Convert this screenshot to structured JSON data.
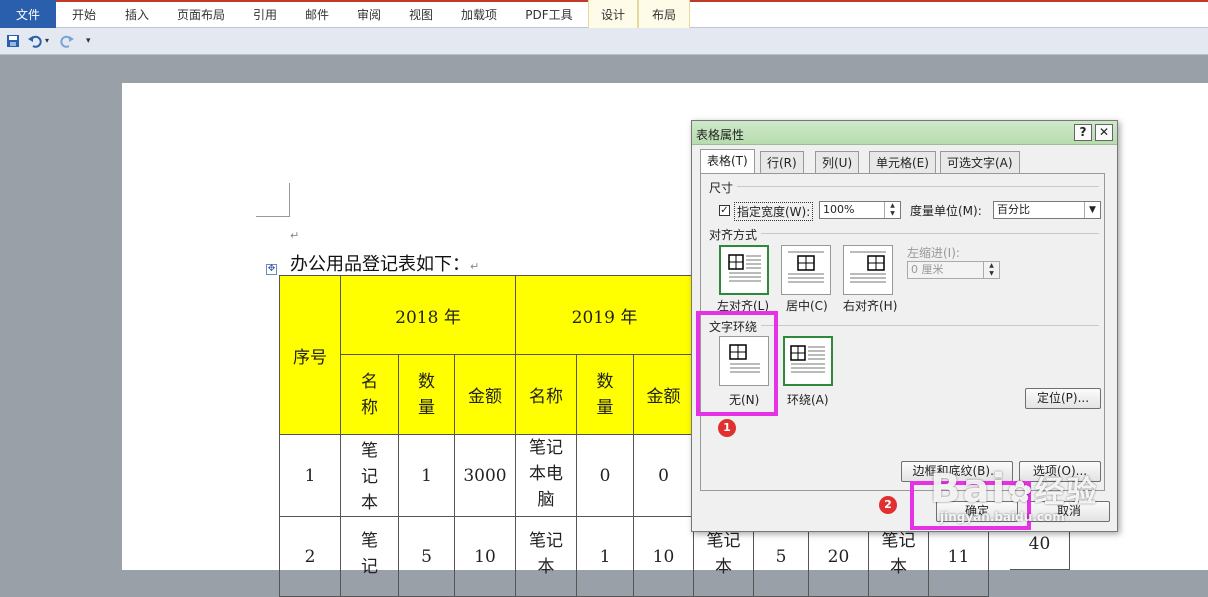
{
  "ribbon": {
    "tabs": [
      "文件",
      "开始",
      "插入",
      "页面布局",
      "引用",
      "邮件",
      "审阅",
      "视图",
      "加载项",
      "PDF工具",
      "设计",
      "布局"
    ]
  },
  "qat": {
    "save_icon": "save-icon",
    "undo_icon": "undo-icon",
    "redo_icon": "redo-icon",
    "more": "▾"
  },
  "document": {
    "intro": "办公用品登记表如下：",
    "para_mark": "↵",
    "table": {
      "header_seq": "序号",
      "year1": "2018 年",
      "year2": "2019 年",
      "sub": [
        "名称",
        "数量",
        "金额",
        "名称",
        "数量",
        "金额"
      ],
      "rows": [
        {
          "seq": "1",
          "name1": "笔记本",
          "qty1": "1",
          "amt1": "3000",
          "name2": "笔记本电脑",
          "qty2": "0",
          "amt2": "0"
        },
        {
          "seq": "2",
          "name1": "笔记",
          "qty1": "5",
          "amt1": "10",
          "name2": "笔记本",
          "qty2": "1",
          "amt2": "10",
          "name3": "笔记本",
          "qty3": "5",
          "amt3": "20",
          "name4": "笔记本",
          "qty4": "11",
          "amt4": "40"
        }
      ]
    }
  },
  "dialog": {
    "title": "表格属性",
    "help": "?",
    "close": "✕",
    "tabs": [
      "表格(T)",
      "行(R)",
      "列(U)",
      "单元格(E)",
      "可选文字(A)"
    ],
    "size_section": "尺寸",
    "specify_width_label": "指定宽度(W):",
    "specify_width_checked": true,
    "width_value": "100%",
    "measure_label": "度量单位(M):",
    "measure_value": "百分比",
    "align_section": "对齐方式",
    "indent_label": "左缩进(I):",
    "indent_value": "0 厘米",
    "align_options": [
      "左对齐(L)",
      "居中(C)",
      "右对齐(H)"
    ],
    "wrap_section": "文字环绕",
    "wrap_options": [
      "无(N)",
      "环绕(A)"
    ],
    "position_btn": "定位(P)...",
    "borders_btn": "边框和底纹(B)...",
    "options_btn": "选项(O)...",
    "ok_btn": "确定",
    "cancel_btn": "取消"
  },
  "annotations": {
    "step1": "1",
    "step2": "2",
    "highlight_color": "#e632e6"
  },
  "watermark": {
    "brand": "Bai",
    "brand2": "经验",
    "url": "jingyan.baidu.com"
  }
}
